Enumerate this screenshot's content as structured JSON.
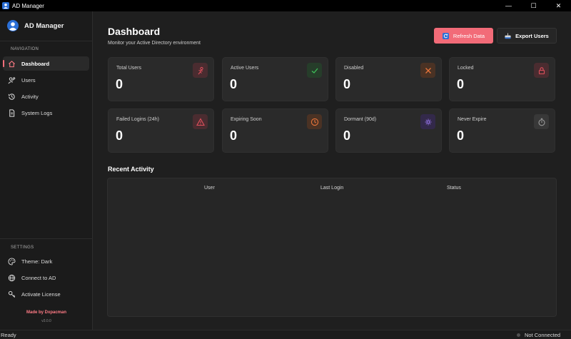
{
  "window": {
    "title": "AD Manager",
    "minimize": "—",
    "maximize": "☐",
    "close": "✕"
  },
  "sidebar": {
    "app_name": "AD Manager",
    "nav_title": "NAVIGATION",
    "nav_items": [
      {
        "label": "Dashboard",
        "icon": "home-icon",
        "active": true
      },
      {
        "label": "Users",
        "icon": "user-key-icon",
        "active": false
      },
      {
        "label": "Activity",
        "icon": "history-icon",
        "active": false
      },
      {
        "label": "System Logs",
        "icon": "document-icon",
        "active": false
      }
    ],
    "settings_title": "SETTINGS",
    "settings_items": [
      {
        "label": "Theme: Dark",
        "icon": "palette-icon"
      },
      {
        "label": "Connect to AD",
        "icon": "globe-icon"
      },
      {
        "label": "Activate License",
        "icon": "key-icon"
      }
    ],
    "made_by": "Made by Dxpacman",
    "version": "v3.0.0"
  },
  "header": {
    "title": "Dashboard",
    "subtitle": "Monitor your Active Directory environment",
    "refresh_label": "Refresh Data",
    "export_label": "Export Users"
  },
  "stats": [
    {
      "label": "Total Users",
      "value": "0",
      "icon": "users-icon",
      "color": "#e0505c"
    },
    {
      "label": "Active Users",
      "value": "0",
      "icon": "check-icon",
      "color": "#3fbf5a"
    },
    {
      "label": "Disabled",
      "value": "0",
      "icon": "x-icon",
      "color": "#e8743a"
    },
    {
      "label": "Locked",
      "value": "0",
      "icon": "lock-icon",
      "color": "#e0505c"
    },
    {
      "label": "Failed Logins (24h)",
      "value": "0",
      "icon": "warning-icon",
      "color": "#e0505c"
    },
    {
      "label": "Expiring Soon",
      "value": "0",
      "icon": "clock-icon",
      "color": "#e8743a"
    },
    {
      "label": "Dormant (90d)",
      "value": "0",
      "icon": "sparkle-icon",
      "color": "#8b6cd8"
    },
    {
      "label": "Never Expire",
      "value": "0",
      "icon": "stopwatch-icon",
      "color": "#8a8a8a"
    }
  ],
  "recent": {
    "title": "Recent Activity",
    "columns": [
      "User",
      "Last Login",
      "Status"
    ]
  },
  "statusbar": {
    "left": "Ready",
    "right": "Not Connected"
  },
  "colors": {
    "accent": "#f26b78",
    "background": "#1f1f1f",
    "card": "#2a2a2a"
  }
}
